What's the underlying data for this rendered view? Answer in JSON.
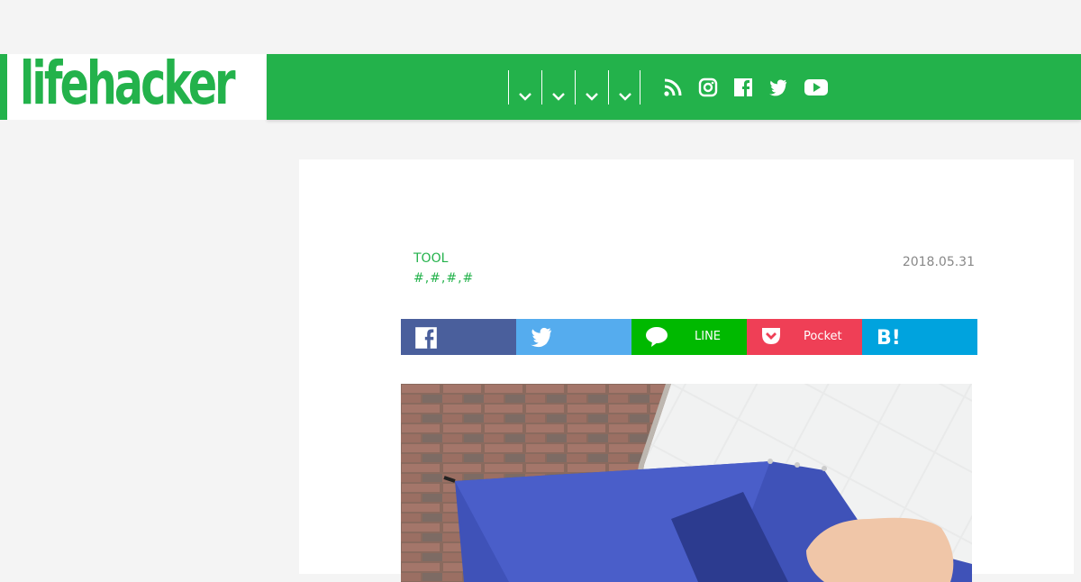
{
  "site": {
    "logo_text": "lifehacker",
    "brand_color": "#23b24b"
  },
  "nav": {
    "menu_items": [
      "dropdown-1",
      "dropdown-2",
      "dropdown-3",
      "dropdown-4"
    ],
    "social_icons": [
      "rss-icon",
      "instagram-icon",
      "facebook-icon",
      "twitter-icon",
      "youtube-icon"
    ]
  },
  "article": {
    "category": "TOOL",
    "tags": "#,#,#,#",
    "date": "2018.05.31"
  },
  "share": {
    "facebook": {
      "label": "",
      "color": "#4a5f9c"
    },
    "twitter": {
      "label": "",
      "color": "#55acee"
    },
    "line": {
      "label": "LINE",
      "color": "#00b900"
    },
    "pocket": {
      "label": "Pocket",
      "color": "#ef3f56"
    },
    "hatena": {
      "label": "",
      "color": "#00a3de"
    }
  },
  "image": {
    "subject": "blue-umbrella-photo"
  }
}
